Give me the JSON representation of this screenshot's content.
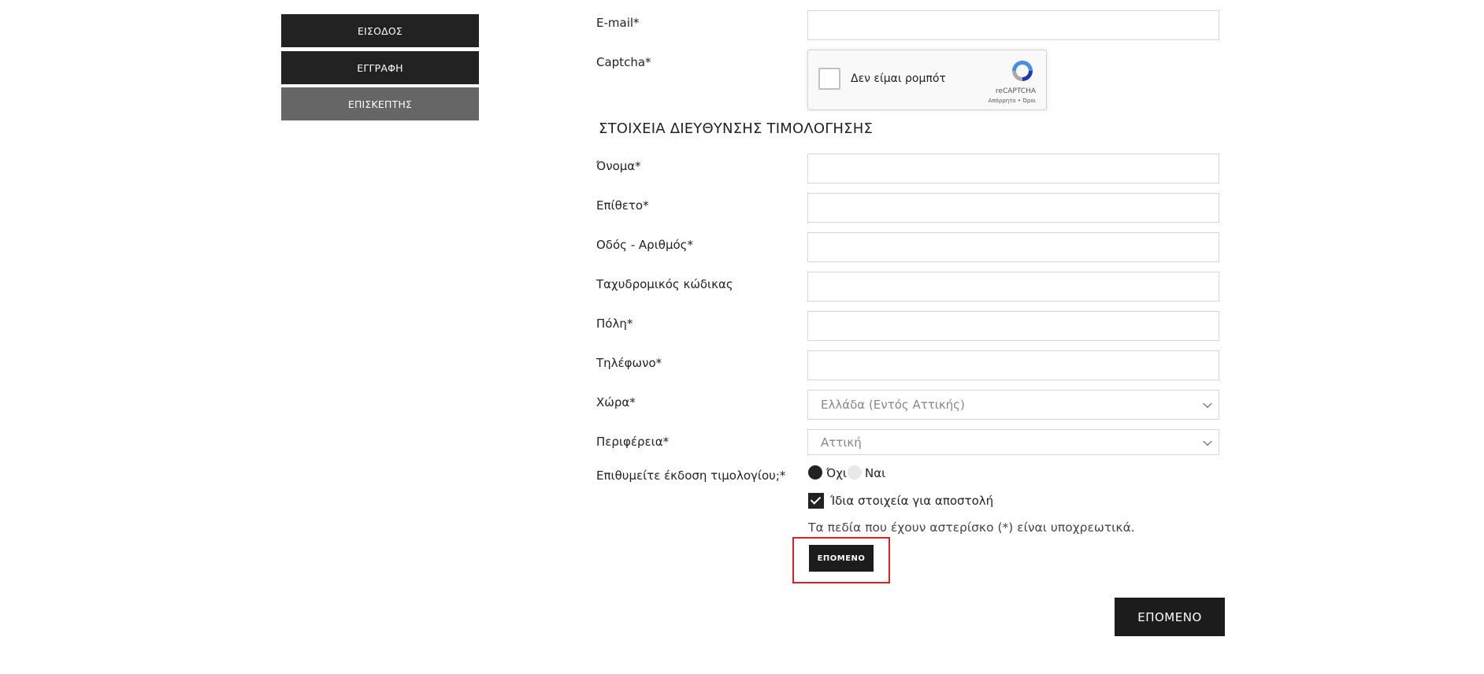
{
  "sidebar": {
    "login_label": "ΕΙΣΟΔΟΣ",
    "register_label": "ΕΓΓΡΑΦΗ",
    "guest_label": "ΕΠΙΣΚΕΠΤΗΣ"
  },
  "account": {
    "email_label": "E-mail*",
    "email_value": "",
    "captcha_label": "Captcha*",
    "captcha_text": "Δεν είμαι ρομπότ",
    "captcha_brand": "reCAPTCHA",
    "captcha_terms": "Απόρρητο • Όροι"
  },
  "billing": {
    "section_title": "ΣΤΟΙΧΕΙΑ ΔΙΕΥΘΥΝΣΗΣ ΤΙΜΟΛΟΓΗΣΗΣ",
    "first_name_label": "Όνομα*",
    "last_name_label": "Επίθετο*",
    "street_label": "Οδός - Αριθμός*",
    "postal_label": "Ταχυδρομικός κώδικας",
    "city_label": "Πόλη*",
    "phone_label": "Τηλέφωνο*",
    "country_label": "Χώρα*",
    "country_value": "Ελλάδα (Εντός Αττικής)",
    "region_label": "Περιφέρεια*",
    "region_value": "Αττική",
    "invoice_label": "Επιθυμείτε έκδοση τιμολογίου;*",
    "invoice_no": "Όχι",
    "invoice_yes": "Ναι",
    "invoice_selected": "Όχι",
    "same_shipping_label": "Ίδια στοιχεία για αποστολή",
    "same_shipping_checked": true,
    "required_note": "Τα πεδία που έχουν αστερίσκο (*) είναι υποχρεωτικά.",
    "next_small_label": "ΕΠΟΜΕΝΟ",
    "next_big_label": "ΕΠΟΜΕΝΟ"
  },
  "colors": {
    "button_dark": "#222222",
    "button_grey": "#666666",
    "highlight": "#e02020"
  }
}
